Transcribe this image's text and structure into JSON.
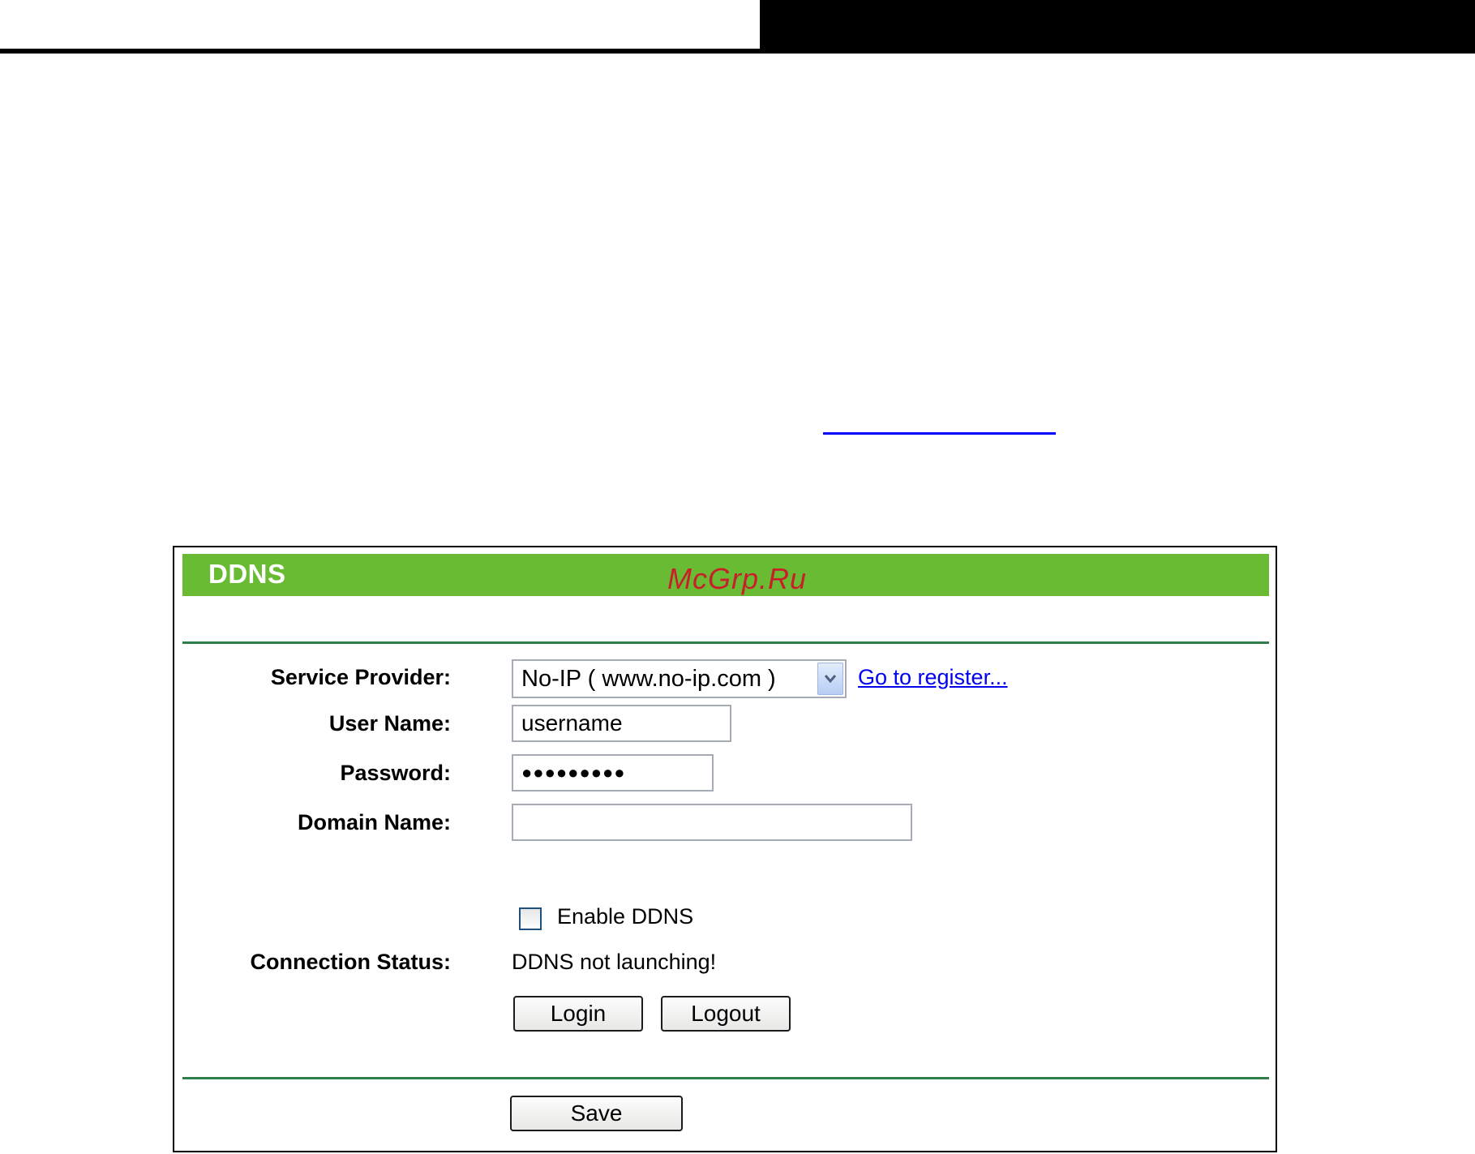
{
  "panel": {
    "title": "DDNS",
    "watermark": "McGrp.Ru"
  },
  "form": {
    "service_provider_label": "Service Provider:",
    "service_provider_value": "No-IP ( www.no-ip.com )",
    "register_link": "Go to register...",
    "user_name_label": "User Name:",
    "user_name_value": "username",
    "password_label": "Password:",
    "password_value": "●●●●●●●●●",
    "domain_name_label": "Domain Name:",
    "domain_name_value": "",
    "enable_ddns_label": "Enable DDNS",
    "enable_ddns_checked": false,
    "connection_status_label": "Connection Status:",
    "connection_status_value": "DDNS not launching!"
  },
  "buttons": {
    "login": "Login",
    "logout": "Logout",
    "save": "Save"
  },
  "colors": {
    "header_green": "#69bb33",
    "divider_green": "#2f7f4a",
    "link_blue": "#0000ee",
    "watermark_red": "#c8202a"
  },
  "icons": {
    "select_arrow": "chevron-down-icon",
    "checkbox": "checkbox-unchecked"
  }
}
